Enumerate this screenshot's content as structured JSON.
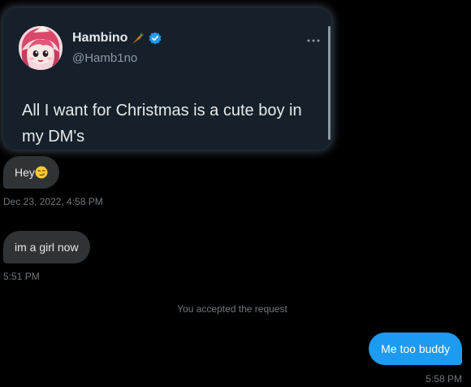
{
  "tweet": {
    "author_name": "Hambino",
    "author_handle": "@Hamb1no",
    "text": "All I want for Christmas is a cute boy in my DM's",
    "name_emoji": "carrot-icon",
    "badge": "verified-icon"
  },
  "messages": [
    {
      "direction": "incoming",
      "text": "Hey",
      "emoji": "smirk-icon",
      "timestamp": "Dec 23, 2022, 4:58 PM"
    },
    {
      "direction": "incoming",
      "text": "im a girl now",
      "timestamp": "5:51 PM"
    },
    {
      "direction": "outgoing",
      "text": "Me too buddy",
      "timestamp": "5:58 PM"
    }
  ],
  "system_notice": "You accepted the request",
  "colors": {
    "background": "#000000",
    "card": "#15202b",
    "incoming_bubble": "#2f3336",
    "outgoing_bubble": "#1d9bf0",
    "verified": "#1d9bf0",
    "muted_text": "#71767b"
  }
}
